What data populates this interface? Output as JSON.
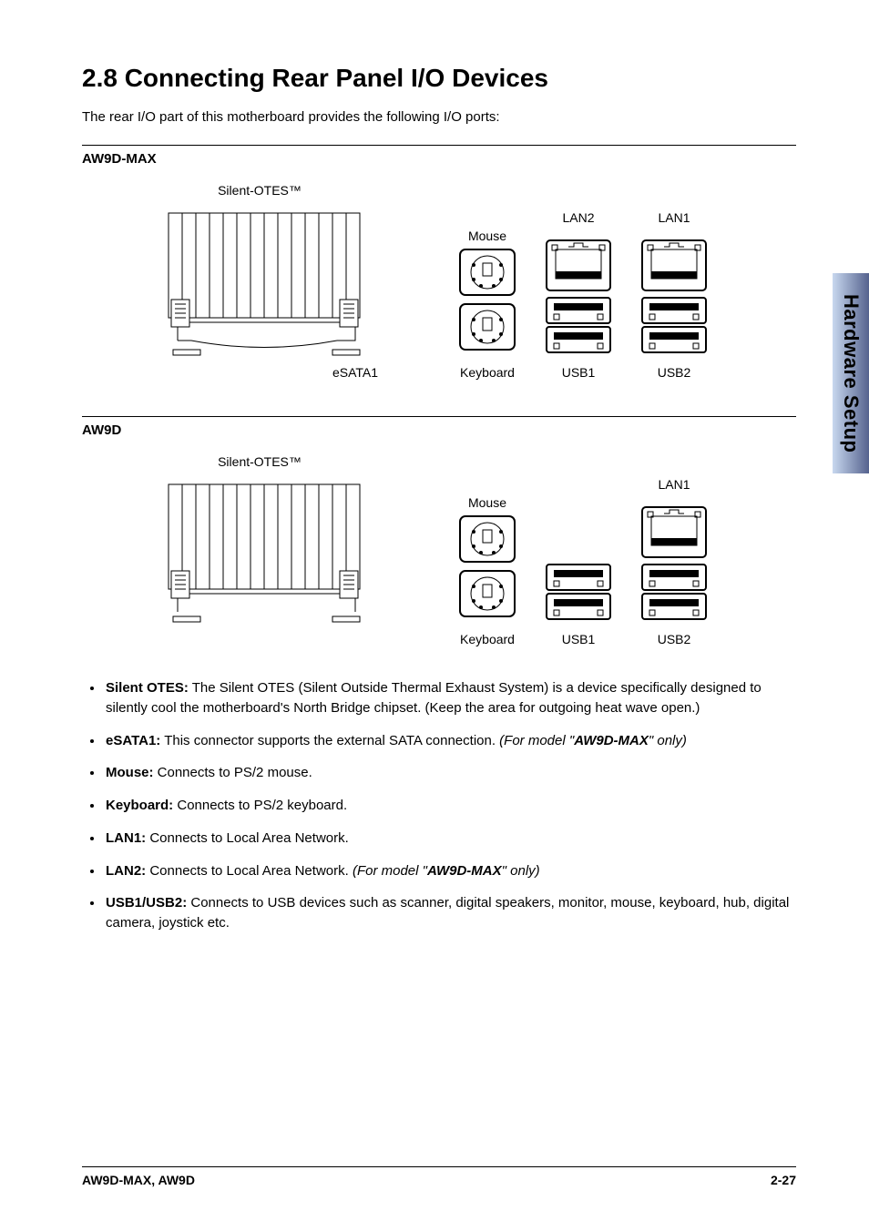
{
  "heading": "2.8 Connecting Rear Panel I/O Devices",
  "intro": "The rear I/O part of this motherboard provides the following I/O ports:",
  "side_tab": "Hardware Setup",
  "section1": {
    "label": "AW9D-MAX",
    "labels": {
      "silent": "Silent-OTES™",
      "esata": "eSATA1",
      "mouse": "Mouse",
      "keyboard": "Keyboard",
      "lan2": "LAN2",
      "lan1": "LAN1",
      "usb1": "USB1",
      "usb2": "USB2"
    }
  },
  "section2": {
    "label": "AW9D",
    "labels": {
      "silent": "Silent-OTES™",
      "mouse": "Mouse",
      "keyboard": "Keyboard",
      "lan1": "LAN1",
      "usb1": "USB1",
      "usb2": "USB2"
    }
  },
  "bullets": [
    {
      "term": "Silent OTES:",
      "body": " The Silent OTES (Silent Outside Thermal Exhaust System) is a device specifically designed to silently cool the motherboard's North Bridge chipset. (Keep the area for outgoing heat wave open.)"
    },
    {
      "term": "eSATA1:",
      "body": " This connector supports the external SATA connection. ",
      "italic_pre": "(For model \"",
      "bolditalic": "AW9D-MAX",
      "italic_post": "\" only)"
    },
    {
      "term": "Mouse:",
      "body": " Connects to PS/2 mouse."
    },
    {
      "term": "Keyboard:",
      "body": " Connects to PS/2 keyboard."
    },
    {
      "term": "LAN1:",
      "body": " Connects to Local Area Network."
    },
    {
      "term": "LAN2:",
      "body": " Connects to Local Area Network. ",
      "italic_pre": "(For model \"",
      "bolditalic": "AW9D-MAX",
      "italic_post": "\" only)"
    },
    {
      "term": "USB1/USB2:",
      "body": " Connects to USB devices such as scanner, digital speakers, monitor, mouse, keyboard, hub, digital camera, joystick etc."
    }
  ],
  "footer": {
    "left": "AW9D-MAX, AW9D",
    "right": "2-27"
  }
}
